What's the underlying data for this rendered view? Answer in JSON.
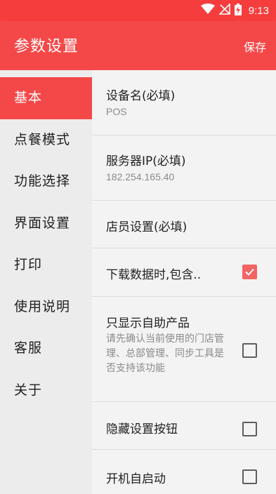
{
  "status_bar": {
    "time": "9:13",
    "icons": [
      "wifi-icon",
      "signal-off-icon",
      "battery-charging-icon"
    ]
  },
  "header": {
    "title": "参数设置",
    "save_label": "保存"
  },
  "sidebar": {
    "items": [
      {
        "label": "基本",
        "active": true
      },
      {
        "label": "点餐模式"
      },
      {
        "label": "功能选择"
      },
      {
        "label": "界面设置"
      },
      {
        "label": "打印"
      },
      {
        "label": "使用说明"
      },
      {
        "label": "客服"
      },
      {
        "label": "关于"
      }
    ]
  },
  "settings": {
    "device_name": {
      "label": "设备名(必填)",
      "value": "POS"
    },
    "server_ip": {
      "label": "服务器IP(必填)",
      "value": "182.254.165.40"
    },
    "clerk": {
      "label": "店员设置(必填)"
    },
    "download_include": {
      "label": "下载数据时,包含..",
      "checked": true
    },
    "self_service_only": {
      "label": "只显示自助产品",
      "description": "请先确认当前使用的门店管理、总部管理、同步工具是否支持该功能",
      "checked": false
    },
    "hide_settings_button": {
      "label": "隐藏设置按钮",
      "checked": false
    },
    "auto_start": {
      "label": "开机自启动",
      "checked": false
    }
  },
  "colors": {
    "accent": "#f44848",
    "status_bar": "#f53d3d",
    "checkbox_checked": "#f26565"
  }
}
